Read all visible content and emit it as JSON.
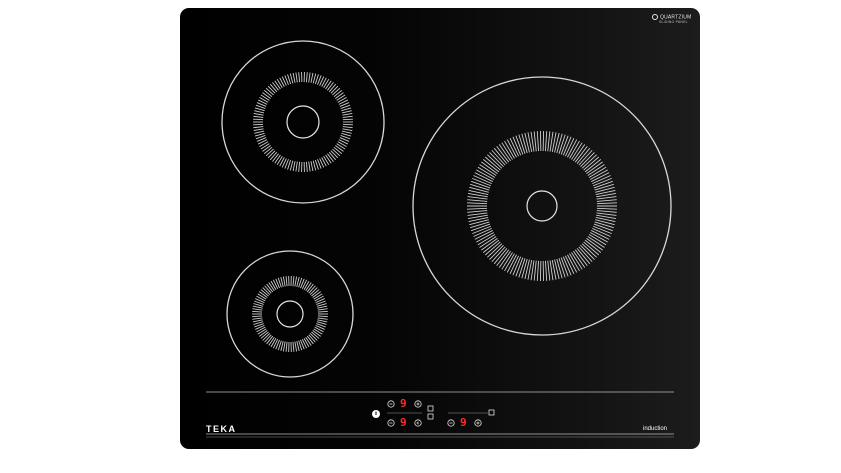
{
  "brand_badge": {
    "name": "QUARTZIUM",
    "tagline": "SLIDING PANEL"
  },
  "logo": "TEKA",
  "label": "induction",
  "displays": {
    "left_top": "9",
    "left_bottom": "9",
    "right": "9"
  },
  "colors": {
    "glass": "#000000",
    "outline": "#d8d8d8",
    "display": "#ff2a2a"
  },
  "icons": [
    "power-icon",
    "minus-icon",
    "plus-icon",
    "timer-icon",
    "lock-icon"
  ]
}
